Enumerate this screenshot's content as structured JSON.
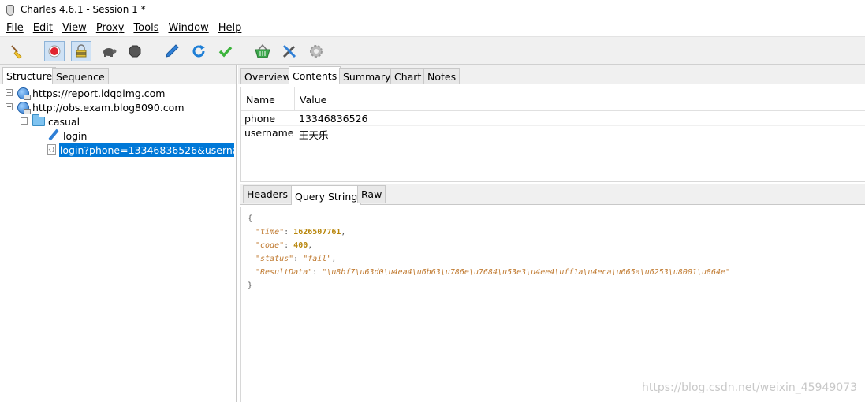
{
  "window": {
    "title": "Charles 4.6.1 - Session 1 *"
  },
  "menu": [
    "File",
    "Edit",
    "View",
    "Proxy",
    "Tools",
    "Window",
    "Help"
  ],
  "toolbar": {
    "icons": [
      "broom-icon",
      "record-icon",
      "ssl-proxy-lock-icon",
      "throttle-turtle-icon",
      "breakpoint-hexagon-icon",
      "compose-pen-icon",
      "repeat-refresh-icon",
      "validate-check-icon",
      "shopping-basket-icon",
      "tools-wrench-icon",
      "settings-gear-icon"
    ]
  },
  "left_tabs": {
    "structure": "Structure",
    "sequence": "Sequence"
  },
  "tree": {
    "host1": "https://report.idqqimg.com",
    "host2": "http://obs.exam.blog8090.com",
    "folder": "casual",
    "item1": "login",
    "item2": "login?phone=13346836526&usernam",
    "expander_plus": "+",
    "expander_minus": "−",
    "doc_glyph": "{}"
  },
  "right_tabs": {
    "overview": "Overview",
    "contents": "Contents",
    "summary": "Summary",
    "chart": "Chart",
    "notes": "Notes"
  },
  "params_table": {
    "header_name": "Name",
    "header_value": "Value",
    "rows": [
      {
        "name": "phone",
        "value": "13346836526"
      },
      {
        "name": "username",
        "value": "王天乐"
      }
    ]
  },
  "sub_tabs": {
    "headers": "Headers",
    "query_string": "Query String",
    "raw": "Raw"
  },
  "json": {
    "open": "{",
    "close": "}",
    "k_time": "\"time\"",
    "v_time": "1626507761",
    "k_code": "\"code\"",
    "v_code": "400",
    "k_status": "\"status\"",
    "v_status": "\"fail\"",
    "k_result": "\"ResultData\"",
    "v_result": "\"\\u8bf7\\u63d0\\u4ea4\\u6b63\\u786e\\u7684\\u53e3\\u4ee4\\uff1a\\u4eca\\u665a\\u6253\\u8001\\u864e\"",
    "colon": ": ",
    "comma": ","
  },
  "watermark": "https://blog.csdn.net/weixin_45949073",
  "colors": {
    "selection": "#0078d7",
    "toolbar_bg": "#f0f0f0",
    "json_key": "#c07a30"
  }
}
